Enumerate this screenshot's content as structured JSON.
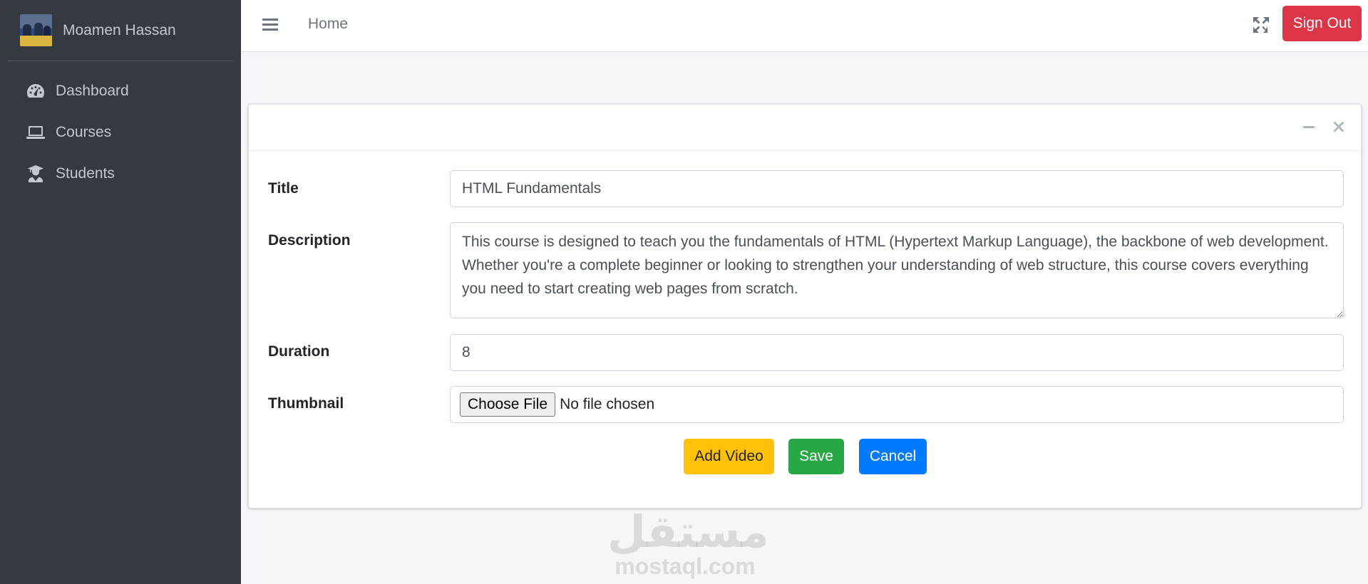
{
  "sidebar": {
    "user_name": "Moamen Hassan",
    "items": [
      {
        "label": "Dashboard",
        "icon": "tachometer-icon"
      },
      {
        "label": "Courses",
        "icon": "laptop-icon"
      },
      {
        "label": "Students",
        "icon": "graduate-icon"
      }
    ]
  },
  "navbar": {
    "home_label": "Home",
    "signout_label": "Sign Out"
  },
  "form": {
    "title_label": "Title",
    "title_value": "HTML Fundamentals",
    "description_label": "Description",
    "description_value": "This course is designed to teach you the fundamentals of HTML (Hypertext Markup Language), the backbone of web development. Whether you're a complete beginner or looking to strengthen your understanding of web structure, this course covers everything you need to start creating web pages from scratch.",
    "duration_label": "Duration",
    "duration_value": "8",
    "thumbnail_label": "Thumbnail",
    "file_button_label": "Choose File",
    "file_status": "No file chosen"
  },
  "actions": {
    "add_video_label": "Add Video",
    "save_label": "Save",
    "cancel_label": "Cancel"
  },
  "colors": {
    "sidebar_bg": "#343a40",
    "danger": "#dc3545",
    "warning": "#ffc107",
    "success": "#28a745",
    "primary": "#007bff"
  },
  "watermark": {
    "arabic": "مستقل",
    "latin": "mostaql.com"
  }
}
